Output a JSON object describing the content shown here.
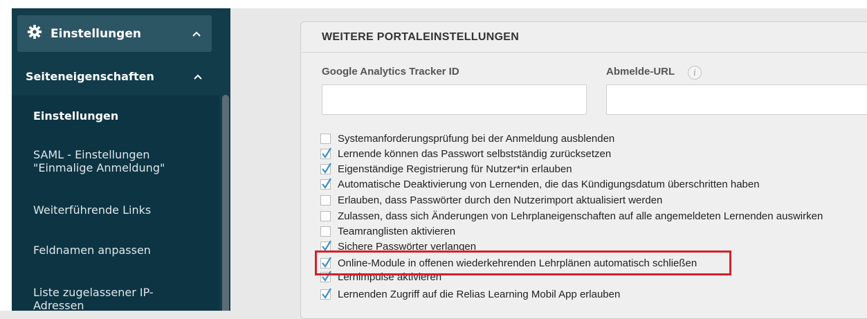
{
  "sidebar": {
    "header_label": "Einstellungen",
    "header_icon": "gear-icon",
    "section_label": "Seiteneigenschaften",
    "items": [
      {
        "label": "Einstellungen",
        "active": true
      },
      {
        "label": "SAML - Einstellungen \"Einmalige Anmeldung\"",
        "active": false
      },
      {
        "label": "Weiterführende Links",
        "active": false
      },
      {
        "label": "Feldnamen anpassen",
        "active": false
      },
      {
        "label": "Liste zugelassener IP-Adressen",
        "active": false
      }
    ]
  },
  "panel": {
    "title": "WEITERE PORTALEINSTELLUNGEN",
    "fields": [
      {
        "label": "Google Analytics Tracker ID",
        "value": ""
      },
      {
        "label": "Abmelde-URL",
        "value": "",
        "info_icon": "i"
      }
    ],
    "checkboxes": [
      {
        "label": "Systemanforderungsprüfung bei der Anmeldung ausblenden",
        "checked": false
      },
      {
        "label": "Lernende können das Passwort selbstständig zurücksetzen",
        "checked": true
      },
      {
        "label": "Eigenständige Registrierung für Nutzer*in erlauben",
        "checked": true
      },
      {
        "label": "Automatische Deaktivierung von Lernenden, die das Kündigungsdatum überschritten haben",
        "checked": true
      },
      {
        "label": "Erlauben, dass Passwörter durch den Nutzerimport aktualisiert werden",
        "checked": false
      },
      {
        "label": "Zulassen, dass sich Änderungen von Lehrplaneigenschaften auf alle angemeldeten Lernenden auswirken",
        "checked": false
      },
      {
        "label": "Teamranglisten aktivieren",
        "checked": false
      },
      {
        "label": "Sichere Passwörter verlangen",
        "checked": true
      },
      {
        "label": "Online-Module in offenen wiederkehrenden Lehrplänen automatisch schließen",
        "checked": true
      },
      {
        "label": "Lernimpulse aktivieren",
        "checked": true
      },
      {
        "label": "Lernenden Zugriff auf die Relias Learning Mobil App erlauben",
        "checked": true
      }
    ]
  },
  "colors": {
    "sidebar_bg": "#123c4a",
    "sidebar_header_bg": "#2d5665",
    "highlight": "#d4202a",
    "check": "#3a8ec7"
  }
}
